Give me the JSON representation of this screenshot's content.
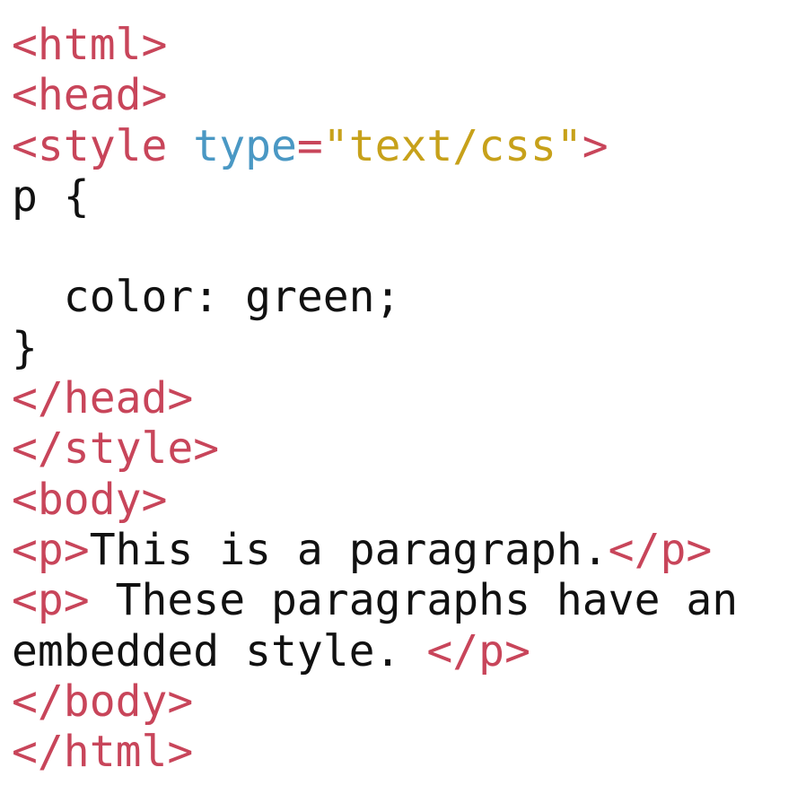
{
  "colors": {
    "tag": "#c8455a",
    "attribute": "#4a98c4",
    "string": "#c7a11a",
    "text": "#111111",
    "background": "#ffffff"
  },
  "lines": [
    [
      {
        "t": "tag",
        "v": "<html>"
      }
    ],
    [
      {
        "t": "tag",
        "v": "<head>"
      }
    ],
    [
      {
        "t": "tag",
        "v": "<style "
      },
      {
        "t": "attr",
        "v": "type"
      },
      {
        "t": "eq",
        "v": "="
      },
      {
        "t": "str",
        "v": "\"text/css\""
      },
      {
        "t": "tag",
        "v": ">"
      }
    ],
    [
      {
        "t": "plain",
        "v": "p {"
      }
    ],
    [
      {
        "t": "plain",
        "v": ""
      }
    ],
    [
      {
        "t": "plain",
        "v": "  color: green;"
      }
    ],
    [
      {
        "t": "plain",
        "v": "}"
      }
    ],
    [
      {
        "t": "tag",
        "v": "</head>"
      }
    ],
    [
      {
        "t": "tag",
        "v": "</style>"
      }
    ],
    [
      {
        "t": "tag",
        "v": "<body>"
      }
    ],
    [
      {
        "t": "tag",
        "v": "<p>"
      },
      {
        "t": "plain",
        "v": "This is a paragraph."
      },
      {
        "t": "tag",
        "v": "</p>"
      }
    ],
    [
      {
        "t": "tag",
        "v": "<p>"
      },
      {
        "t": "plain",
        "v": " These paragraphs have an"
      }
    ],
    [
      {
        "t": "plain",
        "v": "embedded style. "
      },
      {
        "t": "tag",
        "v": "</p>"
      }
    ],
    [
      {
        "t": "tag",
        "v": "</body>"
      }
    ],
    [
      {
        "t": "tag",
        "v": "</html>"
      }
    ]
  ]
}
